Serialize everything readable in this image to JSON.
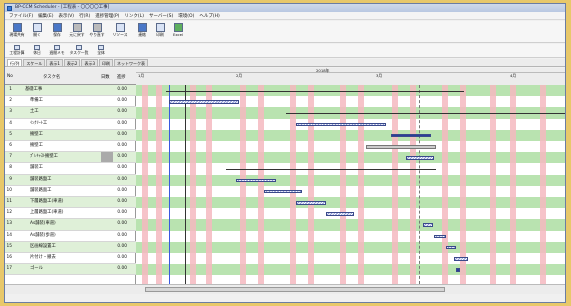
{
  "window": {
    "title": "BP-CCM Scheduler - [工程表 - 〇〇〇〇工事]"
  },
  "menu": [
    "ファイル(F)",
    "編集(E)",
    "表示(V)",
    "行(R)",
    "進捗管理(P)",
    "リンク(L)",
    "サーバー(S)",
    "環境(O)",
    "ヘルプ(H)"
  ],
  "toolbar": [
    {
      "label": "現場共有",
      "icon": "share-icon"
    },
    {
      "label": "開く",
      "icon": "open-icon"
    },
    {
      "label": "保存",
      "icon": "save-icon"
    },
    {
      "label": "元に戻す",
      "icon": "undo-icon"
    },
    {
      "label": "やり直す",
      "icon": "redo-icon"
    },
    {
      "label": "リソース",
      "icon": "resource-icon"
    },
    {
      "label": "連絡",
      "icon": "link-icon"
    },
    {
      "label": "印刷",
      "icon": "print-icon"
    },
    {
      "label": "Excel",
      "icon": "excel-icon"
    }
  ],
  "toolbar2": [
    {
      "label": "工程計算",
      "icon": "calc-icon"
    },
    {
      "label": "休日",
      "icon": "holiday-icon"
    },
    {
      "label": "週間メモ",
      "icon": "memo-icon"
    },
    {
      "label": "タスク一覧",
      "icon": "tasklist-icon"
    },
    {
      "label": "全体",
      "icon": "all-icon"
    }
  ],
  "tabs": [
    "行/列",
    "スケール",
    "表示1",
    "表示2",
    "表示3",
    "印刷",
    "ネットワーク表"
  ],
  "columns": {
    "no": "No",
    "task": "タスク名",
    "days": "日数",
    "progress": "進捗"
  },
  "tasks": [
    {
      "no": "1",
      "name": "基礎工事",
      "value": "0.00",
      "hl": true
    },
    {
      "no": "2",
      "name": "準備工",
      "value": "0.00"
    },
    {
      "no": "3",
      "name": "土工",
      "value": "0.00",
      "hl": true
    },
    {
      "no": "4",
      "name": "ｲﾝｸﾘｰﾄ工",
      "value": "0.00"
    },
    {
      "no": "5",
      "name": "擁壁工",
      "value": "0.00",
      "hl": true
    },
    {
      "no": "6",
      "name": "擁壁工",
      "value": "0.00"
    },
    {
      "no": "7",
      "name": "ﾌﾟﾚｷｬｽﾄ擁壁工",
      "value": "0.00",
      "hl": true,
      "gray": true
    },
    {
      "no": "8",
      "name": "舗装工",
      "value": "0.00"
    },
    {
      "no": "9",
      "name": "舗装路盤工",
      "value": "0.00",
      "hl": true
    },
    {
      "no": "10",
      "name": "舗装路面工",
      "value": "0.00"
    },
    {
      "no": "11",
      "name": "下層路盤工(車道)",
      "value": "0.00",
      "hl": true
    },
    {
      "no": "12",
      "name": "上層路盤工(車道)",
      "value": "0.00"
    },
    {
      "no": "13",
      "name": "As舗装(車道)",
      "value": "0.00",
      "hl": true
    },
    {
      "no": "14",
      "name": "As舗装(歩道)",
      "value": "0.00"
    },
    {
      "no": "15",
      "name": "区画線設置工",
      "value": "0.00",
      "hl": true
    },
    {
      "no": "16",
      "name": "片付け・撤去",
      "value": "0.00"
    },
    {
      "no": "17",
      "name": "ゴール",
      "value": "0.00",
      "hl": true
    }
  ],
  "timeline": {
    "year": "2018年",
    "months": [
      "1月",
      "2月",
      "3月",
      "4月"
    ]
  }
}
